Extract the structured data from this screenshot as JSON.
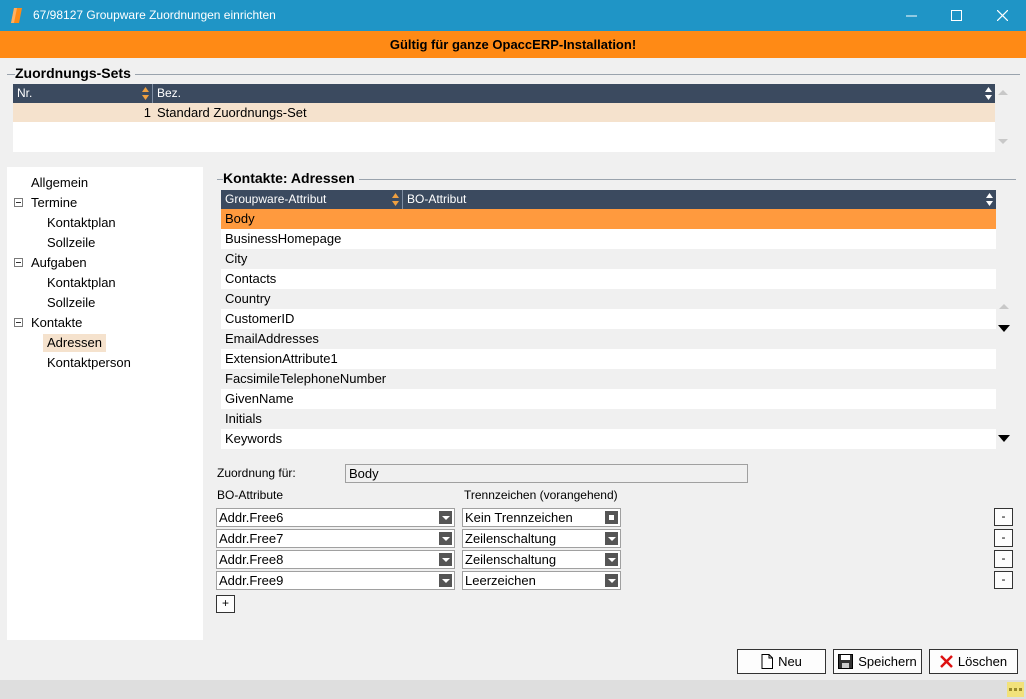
{
  "window": {
    "title": "67/98127 Groupware Zuordnungen einrichten",
    "banner": "Gültig für ganze OpaccERP-Installation!"
  },
  "sets": {
    "title": "Zuordnungs-Sets",
    "columns": [
      "Nr.",
      "Bez."
    ],
    "rows": [
      {
        "nr": "1",
        "bez": "Standard Zuordnungs-Set"
      }
    ]
  },
  "tree": {
    "items": [
      {
        "label": "Allgemein"
      },
      {
        "label": "Termine"
      },
      {
        "label": "Kontaktplan"
      },
      {
        "label": "Sollzeile"
      },
      {
        "label": "Aufgaben"
      },
      {
        "label": "Kontaktplan"
      },
      {
        "label": "Sollzeile"
      },
      {
        "label": "Kontakte"
      },
      {
        "label": "Adressen"
      },
      {
        "label": "Kontaktperson"
      }
    ],
    "selected": "Adressen"
  },
  "contacts": {
    "title": "Kontakte: Adressen",
    "columns": [
      "Groupware-Attribut",
      "BO-Attribut"
    ],
    "rows": [
      "Body",
      "BusinessHomepage",
      "City",
      "Contacts",
      "Country",
      "CustomerID",
      "EmailAddresses",
      "ExtensionAttribute1",
      "FacsimileTelephoneNumber",
      "GivenName",
      "Initials",
      "Keywords"
    ],
    "selected": "Body"
  },
  "mapping": {
    "for_label": "Zuordnung für:",
    "for_value": "Body",
    "bo_label": "BO-Attribute",
    "sep_label": "Trennzeichen (vorangehend)",
    "rows": [
      {
        "attr": "Addr.Free6",
        "sep": "Kein Trennzeichen"
      },
      {
        "attr": "Addr.Free7",
        "sep": "Zeilenschaltung"
      },
      {
        "attr": "Addr.Free8",
        "sep": "Zeilenschaltung"
      },
      {
        "attr": "Addr.Free9",
        "sep": "Leerzeichen"
      }
    ],
    "remove_label": "-",
    "add_label": "+"
  },
  "buttons": {
    "new": "Neu",
    "save": "Speichern",
    "delete": "Löschen"
  },
  "colors": {
    "titlebar": "#1f95c6",
    "banner": "#ff8a15",
    "grid_header": "#3b4a5f",
    "selected_row": "#ff9a3e",
    "selected_light": "#f5e2cd"
  }
}
